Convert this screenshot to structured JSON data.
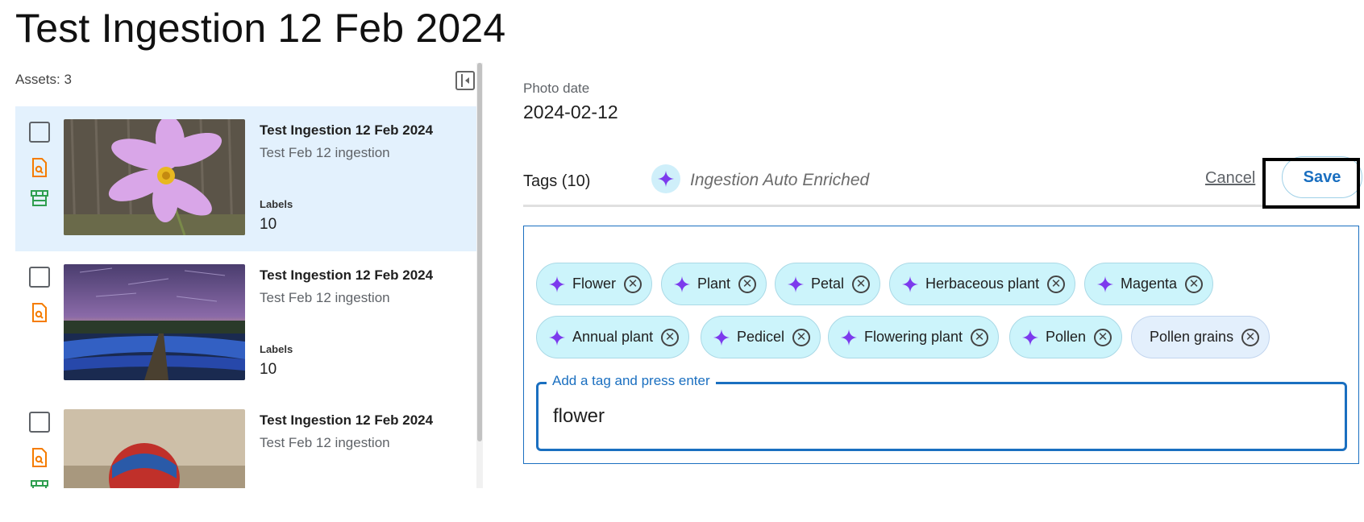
{
  "page": {
    "title": "Test Ingestion 12 Feb 2024"
  },
  "left_panel": {
    "assets_count": "Assets: 3",
    "assets": [
      {
        "title": "Test Ingestion 12 Feb 2024",
        "subtitle": "Test Feb 12 ingestion",
        "labels_caption": "Labels",
        "labels_value": "10",
        "selected": true
      },
      {
        "title": "Test Ingestion 12 Feb 2024",
        "subtitle": "Test Feb 12 ingestion",
        "labels_caption": "Labels",
        "labels_value": "10",
        "selected": false
      },
      {
        "title": "Test Ingestion 12 Feb 2024",
        "subtitle": "Test Feb 12 ingestion",
        "labels_caption": "",
        "labels_value": "",
        "selected": false
      }
    ]
  },
  "details": {
    "photo_date_label": "Photo date",
    "photo_date_value": "2024-02-12",
    "tags_count": "Tags (10)",
    "auto_enriched_label": "Ingestion Auto Enriched",
    "cancel_label": "Cancel",
    "save_label": "Save",
    "tags": [
      {
        "label": "Flower",
        "auto": true
      },
      {
        "label": "Plant",
        "auto": true
      },
      {
        "label": "Petal",
        "auto": true
      },
      {
        "label": "Herbaceous plant",
        "auto": true
      },
      {
        "label": "Magenta",
        "auto": true
      },
      {
        "label": "Annual plant",
        "auto": true
      },
      {
        "label": "Pedicel",
        "auto": true
      },
      {
        "label": "Flowering plant",
        "auto": true
      },
      {
        "label": "Pollen",
        "auto": true
      },
      {
        "label": "Pollen grains",
        "auto": false
      }
    ],
    "tag_input": {
      "legend": "Add a tag and press enter",
      "value": "flower"
    }
  },
  "colors": {
    "accent": "#1a6fc0",
    "selected_row": "#e3f1fd",
    "auto_chip": "#ccf4fb",
    "manual_chip": "#e3effc",
    "sparkle": "#7c3aed",
    "doc_icon": "#f57c00",
    "store_icon": "#2e9e4f"
  },
  "icons": {
    "sparkle": "sparkle-icon",
    "remove": "close-circle-icon",
    "collapse": "panel-collapse-icon",
    "document_search": "document-search-icon",
    "storefront": "storefront-icon"
  }
}
